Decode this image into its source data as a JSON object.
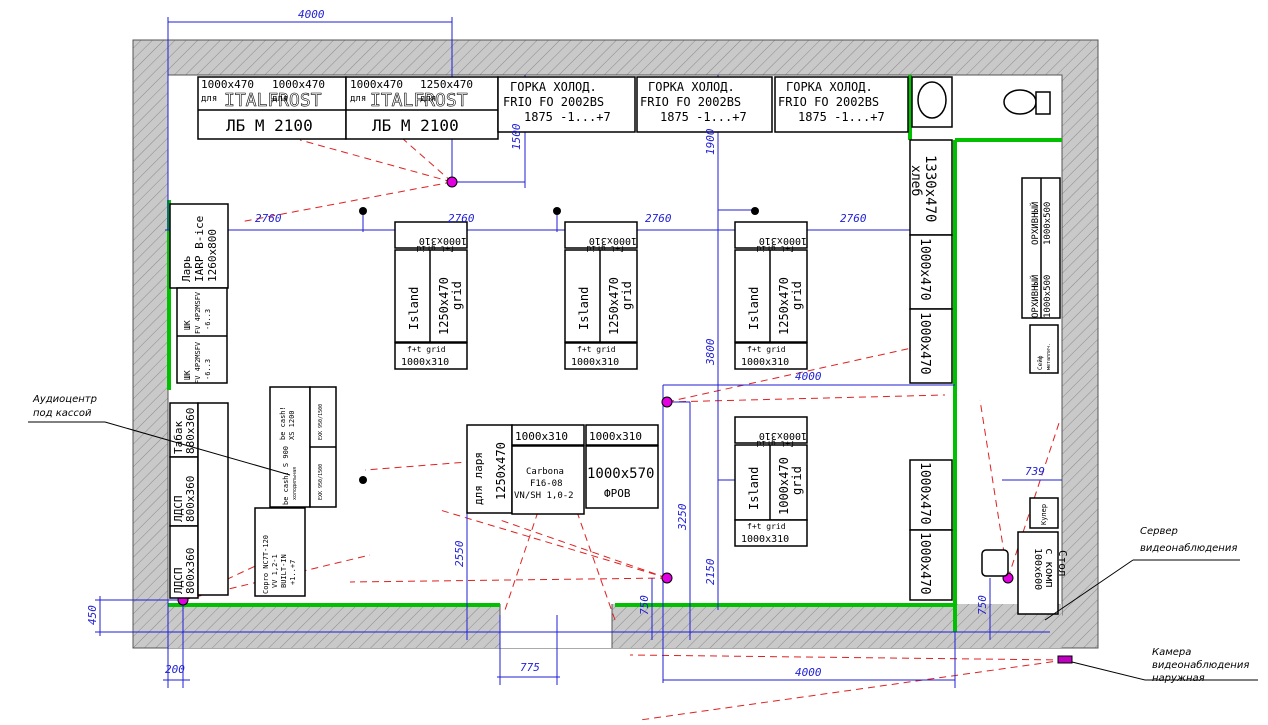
{
  "colors": {
    "wall": "#808080",
    "dimension": "#1f1fd6",
    "camera_line": "#e02020",
    "green_wall": "#00c000",
    "camera": "#e000e0",
    "magenta_box": "#c000c0",
    "text": "#000000"
  },
  "dimensions": {
    "top_4000": "4000",
    "row_2760_a": "2760",
    "row_2760_b": "2760",
    "row_2760_c": "2760",
    "row_2760_d": "2760",
    "v_1500": "1500",
    "v_1900": "1900",
    "v_3800": "3800",
    "mid_4000": "4000",
    "v_3250": "3250",
    "v_2550": "2550",
    "v_2150": "2150",
    "v_750_a": "750",
    "v_750_b": "750",
    "h_775": "775",
    "h_739": "739",
    "bottom_4000": "4000",
    "v_450": "450",
    "h_200": "200"
  },
  "top_wall": {
    "fridge_small": [
      {
        "line1": "1000x470",
        "line2": "для"
      },
      {
        "line1": "1000x470",
        "line2": "для"
      },
      {
        "line1": "1000x470",
        "line2": "для"
      },
      {
        "line1": "1250x470",
        "line2": "для"
      }
    ],
    "fridge_large": [
      {
        "line1": "ITALFROST",
        "line2": "ЛБ М 2100"
      },
      {
        "line1": "ITALFROST",
        "line2": "ЛБ М 2100"
      }
    ],
    "gorka": [
      {
        "line1": "ГОРКА ХОЛОД.",
        "line2": "FRIO FO 2002BS",
        "line3": "1875 -1...+7"
      },
      {
        "line1": "ГОРКА ХОЛОД.",
        "line2": "FRIO FO 2002BS",
        "line3": "1875 -1...+7"
      },
      {
        "line1": "ГОРКА ХОЛОД.",
        "line2": "FRIO FO 2002BS",
        "line3": "1875 -1...+7"
      }
    ]
  },
  "islands": [
    {
      "top": "1000x310",
      "top2": "f+t grid",
      "left": "Island",
      "right": "1250x470",
      "right2": "grid",
      "bot": "f+t grid",
      "bot2": "1000x310"
    },
    {
      "top": "1000x310",
      "top2": "f+t grid",
      "left": "Island",
      "right": "1250x470",
      "right2": "grid",
      "bot": "f+t grid",
      "bot2": "1000x310"
    },
    {
      "top": "1000x310",
      "top2": "f+t grid",
      "left": "Island",
      "right": "1250x470",
      "right2": "grid",
      "bot": "f+t grid",
      "bot2": "1000x310"
    },
    {
      "top": "1000x310",
      "top2": "f+t grid",
      "left": "Island",
      "right": "1000x470",
      "right2": "grid",
      "bot": "f+t grid",
      "bot2": "1000x310"
    }
  ],
  "left_wall": {
    "lar": {
      "line1": "Ларь",
      "line2": "IARP B-ice",
      "line3": "1260x800"
    },
    "shk1": {
      "line1": "ШК",
      "line2": "FV 4P2MSFV",
      "line3": "-6..3"
    },
    "shk2": {
      "line1": "ШК",
      "line2": "FV 4P2MSFV",
      "line3": "-6..3"
    },
    "tabak": {
      "line1": "Табак",
      "line2": "880x360"
    },
    "ldsp1": {
      "line1": "ЛДСП",
      "line2": "800x360"
    },
    "ldsp2": {
      "line1": "ЛДСП",
      "line2": "800x360"
    }
  },
  "checkout": {
    "casio": {
      "line1": "Copro NC7T-120",
      "line2": "VV 1,2-1",
      "line3": "BUILT-IN",
      "line4": "+1..+7"
    },
    "be_cash_900": {
      "line1": "be cash! S 900",
      "line2": "холодильная"
    },
    "be_cash_1200": {
      "line1": "be cash!",
      "line2": "XS 1200"
    },
    "small_a": "ЕХК 950/1500",
    "small_b": "ЕХК 950/1500"
  },
  "center": {
    "lar_box": {
      "line1": "для ларя",
      "line2": "1250x470"
    },
    "top_a": "1000x310",
    "top_b": "1000x310",
    "carbona": {
      "line1": "Carbona",
      "line2": "F16-08",
      "line3": "VN/SH 1,0-2"
    },
    "frov": {
      "line1": "1000x570",
      "line2": "ФРОВ"
    }
  },
  "right_wall": {
    "hleb": {
      "line1": "1330x470",
      "line2": "хлеб"
    },
    "r1": "1000x470",
    "r2": "1000x470",
    "r3": "1000x470",
    "r4": "1000x470",
    "archive": {
      "line1": "ОРХИВНЫЙ",
      "line2": "1000x500",
      "line3": "ОРХИВНЫЙ",
      "line4": "1000x500"
    },
    "safe": {
      "line1": "Сейф",
      "line2": "металлич."
    },
    "kuler": "Кулер",
    "desk": {
      "line1": "Стол",
      "line2": "с комп",
      "line3": "100x600"
    }
  },
  "annotations": {
    "audio_1": "Аудиоцентр",
    "audio_2": "под кассой",
    "server_1": "Сервер",
    "server_2": "видеонаблюдения",
    "camera_1": "Камера",
    "camera_2": "видеонаблюдения",
    "camera_3": "наружная"
  }
}
